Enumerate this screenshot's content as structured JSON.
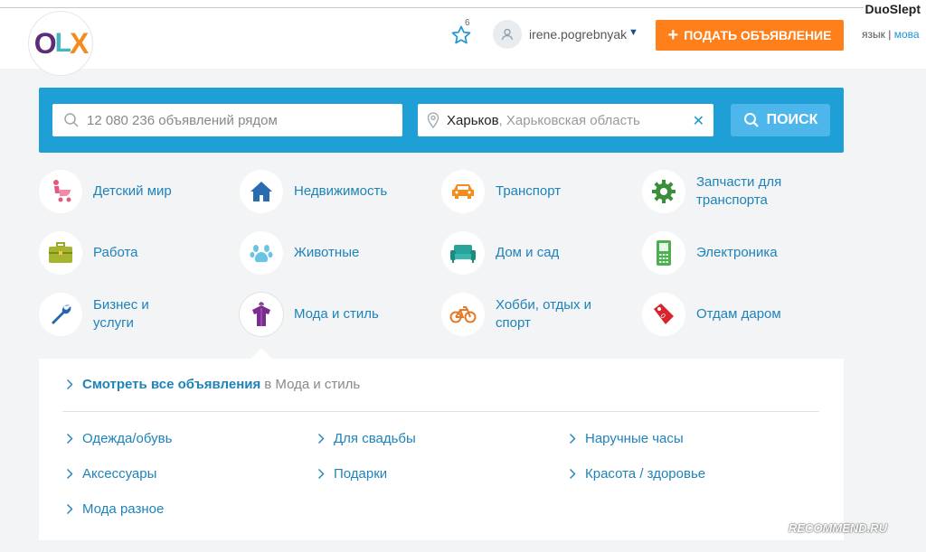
{
  "header": {
    "watermark_user": "DuoSlept",
    "logo": {
      "o": "O",
      "l": "L",
      "x": "X"
    },
    "favorites_count": "6",
    "username": "irene.pogrebnyak",
    "post_button_label": "ПОДАТЬ ОБЪЯВЛЕНИЕ",
    "lang_label": "язык",
    "lang_separator": "|",
    "lang_link": "мова"
  },
  "search": {
    "placeholder": "12 080 236 объявлений рядом",
    "location_city": "Харьков",
    "location_region": ", Харьковская область",
    "clear_symbol": "✕",
    "button_label": "ПОИСК"
  },
  "categories": [
    {
      "label": "Детский мир",
      "icon": "stroller-icon"
    },
    {
      "label": "Недвижимость",
      "icon": "house-icon"
    },
    {
      "label": "Транспорт",
      "icon": "car-icon"
    },
    {
      "label": "Запчасти для транспорта",
      "icon": "gear-icon"
    },
    {
      "label": "Работа",
      "icon": "briefcase-icon"
    },
    {
      "label": "Животные",
      "icon": "paw-icon"
    },
    {
      "label": "Дом и сад",
      "icon": "sofa-icon"
    },
    {
      "label": "Электроника",
      "icon": "phone-icon"
    },
    {
      "label": "Бизнес и услуги",
      "icon": "wrench-icon"
    },
    {
      "label": "Мода и стиль",
      "icon": "clothes-icon"
    },
    {
      "label": "Хобби, отдых и спорт",
      "icon": "bicycle-icon"
    },
    {
      "label": "Отдам даром",
      "icon": "tag-icon"
    }
  ],
  "panel": {
    "view_all_strong": "Смотреть все объявления",
    "view_all_muted": "в Мода и стиль",
    "subcategories": [
      "Одежда/обувь",
      "Для свадьбы",
      "Наручные часы",
      "Аксессуары",
      "Подарки",
      "Красота / здоровье",
      "Мода разное"
    ]
  },
  "watermark_site": "RECOMMEND.RU",
  "colors": {
    "brand_blue": "#1ea0d6",
    "accent_orange": "#ff7f1a",
    "link_blue": "#1f83b8"
  }
}
